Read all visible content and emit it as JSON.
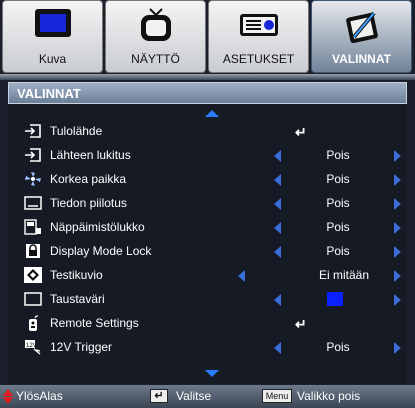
{
  "tabs": [
    {
      "label": "Kuva",
      "icon": "monitor-icon"
    },
    {
      "label": "NÄYTTÖ",
      "icon": "tv-icon"
    },
    {
      "label": "ASETUKSET",
      "icon": "projector-icon"
    },
    {
      "label": "VALINNAT",
      "icon": "notepad-icon",
      "active": true
    }
  ],
  "header": {
    "title": "VALINNAT"
  },
  "rows": [
    {
      "label": "Tulolähde",
      "icon": "input-icon",
      "control": "enter"
    },
    {
      "label": "Lähteen lukitus",
      "icon": "input-icon",
      "value": "Pois"
    },
    {
      "label": "Korkea paikka",
      "icon": "fan-icon",
      "value": "Pois"
    },
    {
      "label": "Tiedon piilotus",
      "icon": "info-hide-icon",
      "value": "Pois"
    },
    {
      "label": "Näppäimistölukko",
      "icon": "keypad-lock-icon",
      "value": "Pois"
    },
    {
      "label": "Display Mode Lock",
      "icon": "display-lock-icon",
      "value": "Pois"
    },
    {
      "label": "Testikuvio",
      "icon": "test-pattern-icon",
      "value": "Ei mitään"
    },
    {
      "label": "Taustaväri",
      "icon": "background-color-icon",
      "control": "color",
      "color": "#0a20ff"
    },
    {
      "label": "Remote Settings",
      "icon": "remote-icon",
      "control": "enter"
    },
    {
      "label": "12V Trigger",
      "icon": "trigger-icon",
      "value": "Pois"
    }
  ],
  "footer": {
    "move": "YlösAlas",
    "select": "Valitse",
    "menu_key": "Menu",
    "exit": "Valikko pois"
  },
  "colors": {
    "accent": "#2a7bff",
    "header": "#8a9db5",
    "swatch": "#0a20ff",
    "footer_arrows": "#e21a1a"
  }
}
